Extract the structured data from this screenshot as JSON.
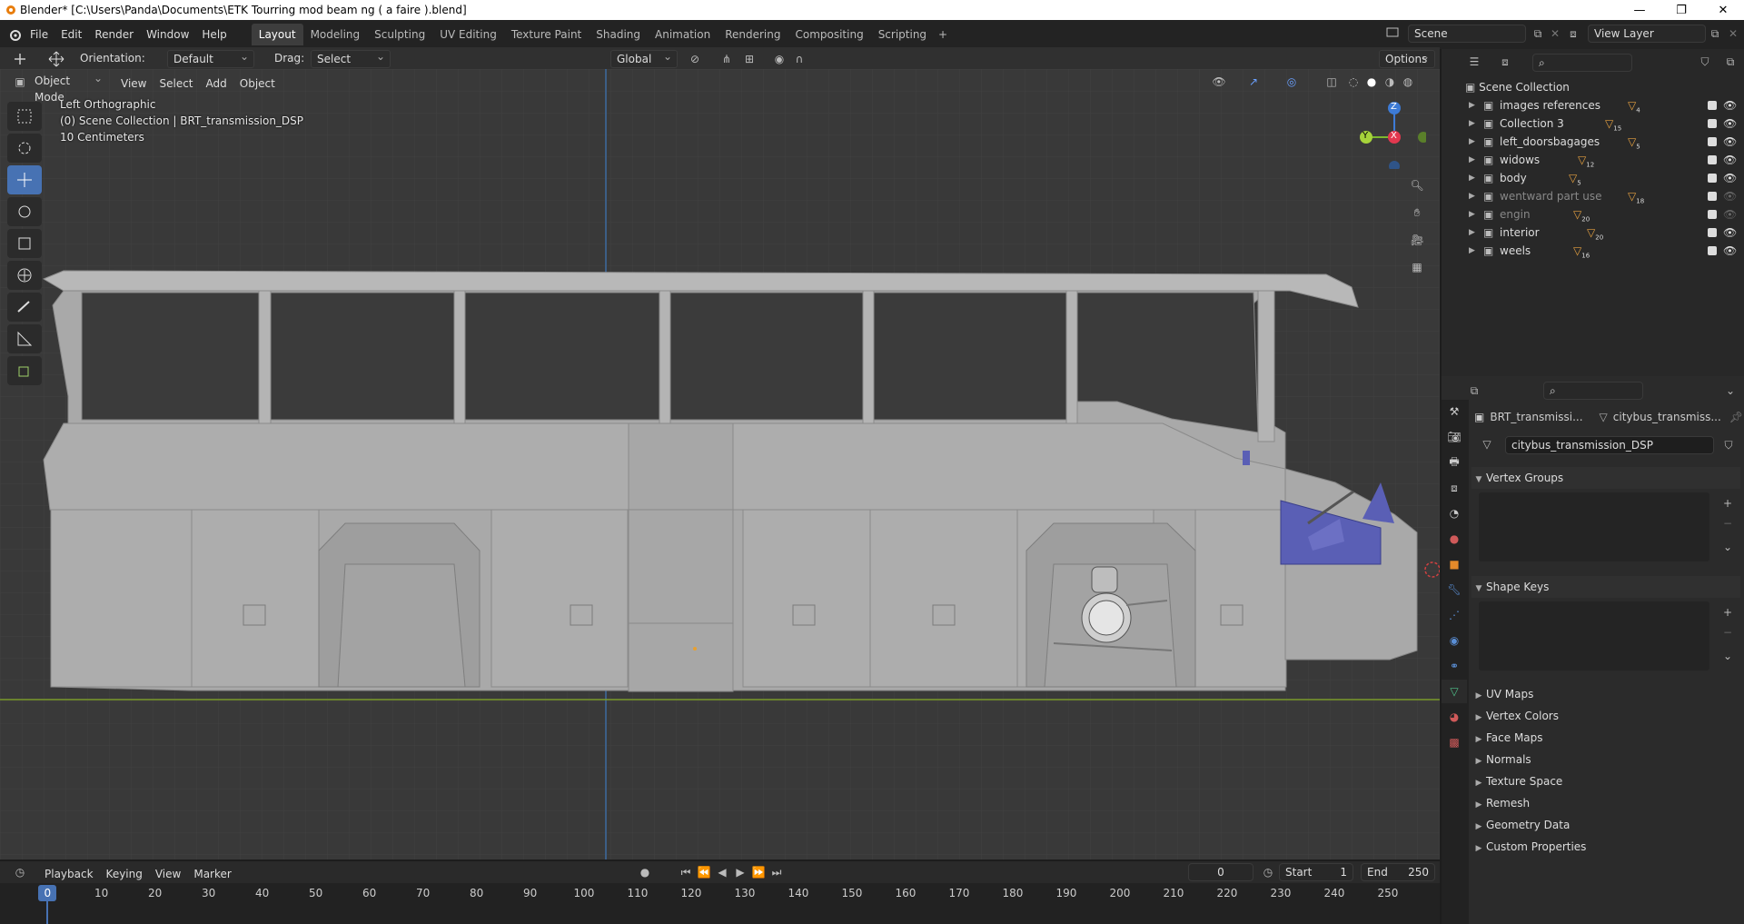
{
  "window": {
    "title": "Blender* [C:\\Users\\Panda\\Documents\\ETK Tourring mod beam ng ( a faire ).blend]"
  },
  "menus": [
    "File",
    "Edit",
    "Render",
    "Window",
    "Help"
  ],
  "workspaces": [
    {
      "label": "Layout",
      "active": true
    },
    {
      "label": "Modeling"
    },
    {
      "label": "Sculpting"
    },
    {
      "label": "UV Editing"
    },
    {
      "label": "Texture Paint"
    },
    {
      "label": "Shading"
    },
    {
      "label": "Animation"
    },
    {
      "label": "Rendering"
    },
    {
      "label": "Compositing"
    },
    {
      "label": "Scripting"
    }
  ],
  "scene": {
    "name": "Scene",
    "view_layer": "View Layer"
  },
  "tool_settings": {
    "orientation_label": "Orientation:",
    "orientation_value": "Default",
    "drag_label": "Drag:",
    "drag_value": "Select Box",
    "transform_orientation": "Global",
    "options": "Options"
  },
  "header": {
    "mode": "Object Mode",
    "menus": [
      "View",
      "Select",
      "Add",
      "Object"
    ]
  },
  "viewport": {
    "view_name": "Left Orthographic",
    "collection_info": "(0) Scene Collection | BRT_transmission_DSP",
    "scale": "10 Centimeters",
    "gizmo": {
      "z": "Z",
      "y": "Y",
      "x": "X"
    }
  },
  "outliner": {
    "root": "Scene Collection",
    "items": [
      {
        "name": "images references",
        "count": "4",
        "dim": false
      },
      {
        "name": "Collection 3",
        "count": "15",
        "dim": false
      },
      {
        "name": "left_doorsbagages",
        "count": "5",
        "dim": false
      },
      {
        "name": "widows",
        "count": "12",
        "dim": false
      },
      {
        "name": "body",
        "count": "5",
        "dim": false
      },
      {
        "name": "wentward part use",
        "count": "18",
        "dim": true
      },
      {
        "name": "engin",
        "count": "20",
        "dim": true
      },
      {
        "name": "interior",
        "count": "20",
        "dim": false
      },
      {
        "name": "weels",
        "count": "16",
        "dim": false
      }
    ]
  },
  "properties": {
    "object": "BRT_transmissi...",
    "mesh": "citybus_transmiss...",
    "data_name": "citybus_transmission_DSP",
    "panels_open": [
      "Vertex Groups",
      "Shape Keys"
    ],
    "panels_closed": [
      "UV Maps",
      "Vertex Colors",
      "Face Maps",
      "Normals",
      "Texture Space",
      "Remesh",
      "Geometry Data",
      "Custom Properties"
    ]
  },
  "timeline": {
    "menus": [
      "Playback",
      "Keying",
      "View",
      "Marker"
    ],
    "current_frame": "0",
    "start_label": "Start",
    "start": "1",
    "end_label": "End",
    "end": "250",
    "ticks": [
      "0",
      "10",
      "20",
      "30",
      "40",
      "50",
      "60",
      "70",
      "80",
      "90",
      "100",
      "110",
      "120",
      "130",
      "140",
      "150",
      "160",
      "170",
      "180",
      "190",
      "200",
      "210",
      "220",
      "230",
      "240",
      "250"
    ]
  }
}
